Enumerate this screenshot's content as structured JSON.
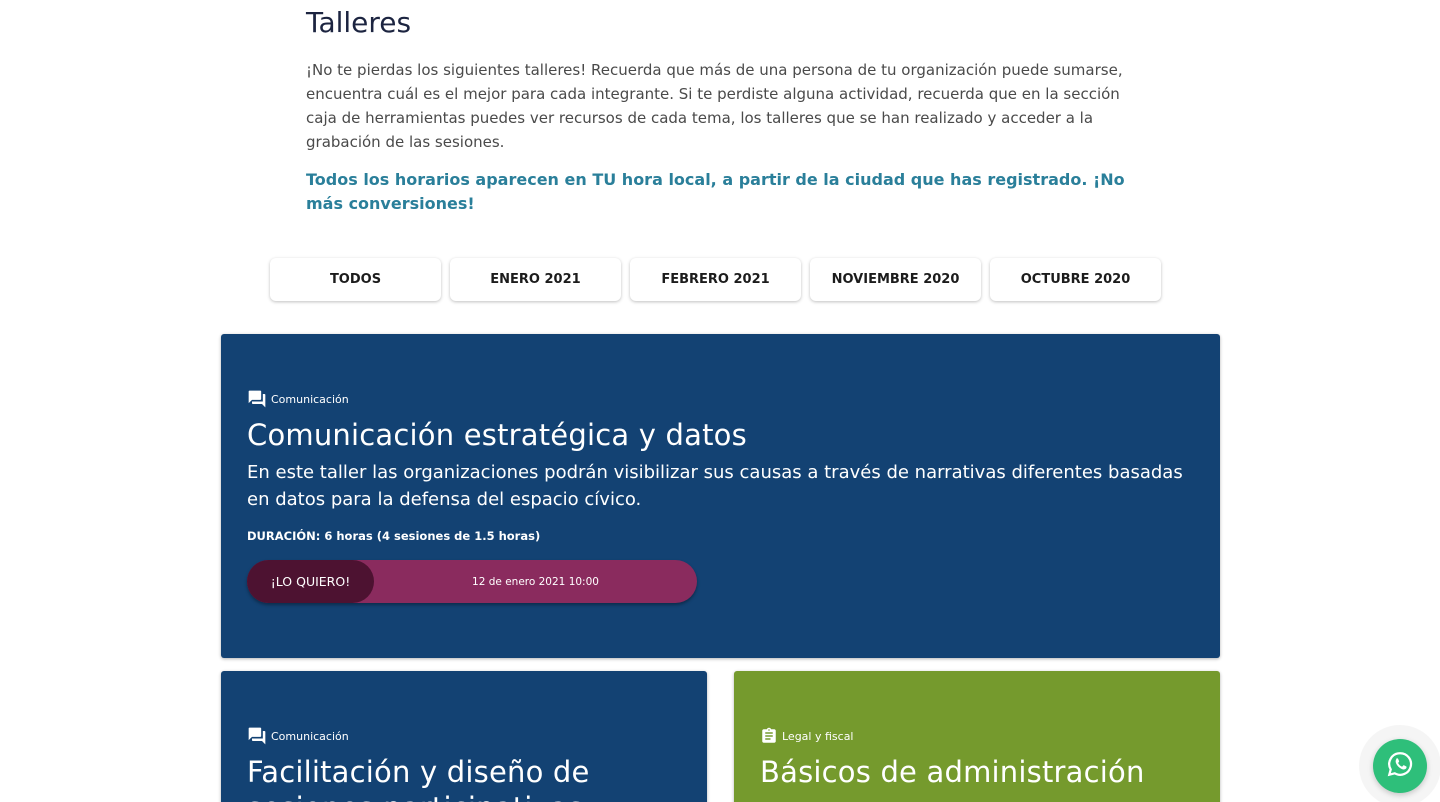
{
  "intro": {
    "title": "Talleres",
    "description": "¡No te pierdas los siguientes talleres! Recuerda que más de una persona de tu organización puede sumarse, encuentra cuál es el mejor para cada integrante. Si te perdiste alguna actividad, recuerda que en la sección caja de herramientas puedes ver recursos de cada tema, los talleres que se han realizado y acceder a la grabación de las sesiones.",
    "note": "Todos los horarios aparecen en TU hora local, a partir de la ciudad que has registrado. ¡No más conversiones!"
  },
  "filters": [
    {
      "label": "TODOS"
    },
    {
      "label": "ENERO 2021"
    },
    {
      "label": "FEBRERO 2021"
    },
    {
      "label": "NOVIEMBRE 2020"
    },
    {
      "label": "OCTUBRE 2020"
    }
  ],
  "cards": [
    {
      "category": "Comunicación",
      "category_icon": "chat-icon",
      "title": "Comunicación estratégica y datos",
      "description": "En este taller las organizaciones podrán visibilizar sus causas a través de narrativas diferentes basadas en datos para la defensa del espacio cívico.",
      "duration": "DURACIÓN: 6 horas (4 sesiones de 1.5 horas)",
      "cta_label": "¡LO QUIERO!",
      "date": "12 de enero 2021 10:00",
      "color": "#134273"
    },
    {
      "category": "Comunicación",
      "category_icon": "chat-icon",
      "title": "Facilitación y diseño de sesiones participativas",
      "color": "#134273"
    },
    {
      "category": "Legal y fiscal",
      "category_icon": "clipboard-icon",
      "title": "Básicos de administración",
      "color": "#759a2d"
    }
  ],
  "colors": {
    "accent_teal": "#2a7f9a",
    "cta_bar": "#8a2b5e",
    "cta_button": "#4d1231",
    "whatsapp": "#2ebf7a"
  },
  "whatsapp": {
    "icon": "whatsapp-icon"
  }
}
